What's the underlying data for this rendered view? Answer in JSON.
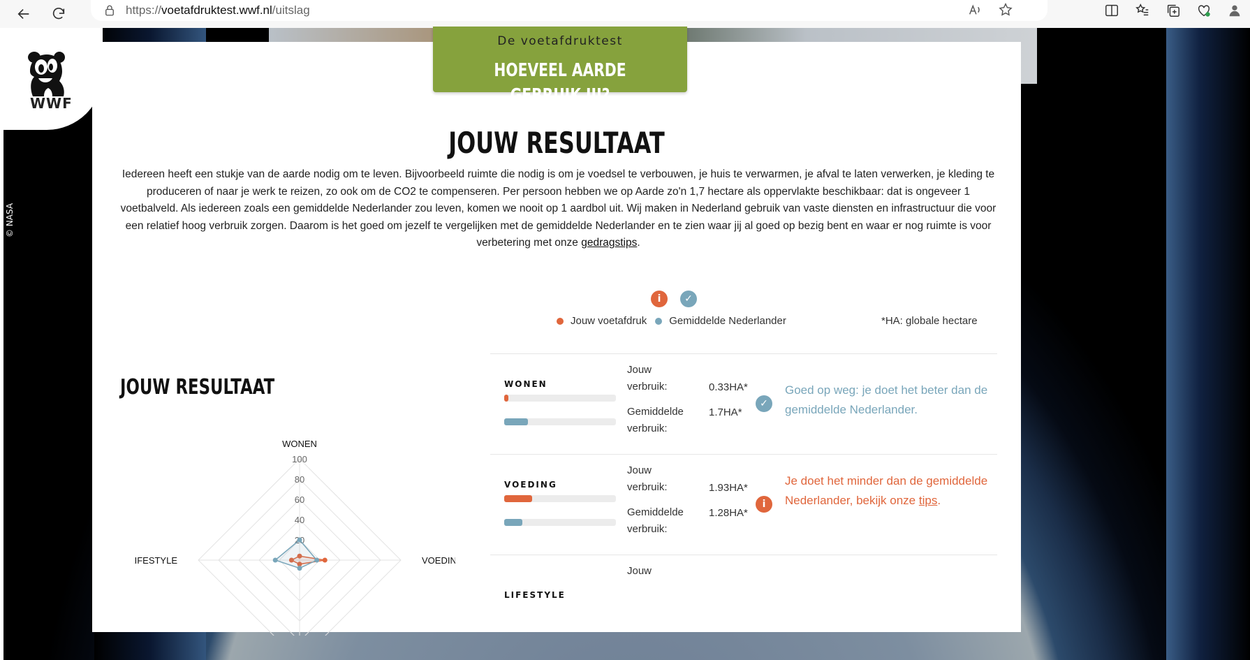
{
  "browser": {
    "url_prefix": "https://",
    "url_domain": "voetafdruktest.wwf.nl",
    "url_path": "/uitslag"
  },
  "brand": {
    "logo_text": "WWF",
    "image_credit": "© NASA"
  },
  "header": {
    "kicker": "De voetafdruktest",
    "headline": "HOEVEEL AARDE GEBRUIK JIJ?"
  },
  "result": {
    "title": "JOUW RESULTAAT",
    "intro": "Iedereen heeft een stukje van de aarde nodig om te leven. Bijvoorbeeld ruimte die nodig is om je voedsel te verbouwen, je huis te verwarmen, je afval te laten verwerken, je kleding te produceren of naar je werk te reizen, zo ook om de CO2 te compenseren. Per persoon hebben we op Aarde zo'n 1,7 hectare als oppervlakte beschikbaar: dat is ongeveer 1 voetbalveld. Als iedereen zoals een gemiddelde Nederlander zou leven, komen we nooit op 1 aardbol uit. Wij maken in Nederland gebruik van vaste diensten en infrastructuur die voor een relatief hoog verbruik zorgen. Daarom is het goed om jezelf te vergelijken met de gemiddelde Nederlander en te zien waar jij al goed op bezig bent en waar er nog ruimte is voor verbetering met onze",
    "intro_link": "gedragstips",
    "intro_end": "."
  },
  "legend": {
    "yours": "Jouw voetafdruk",
    "average": "Gemiddelde Nederlander",
    "ha_note": "*HA: globale hectare",
    "info_symbol": "i",
    "check_symbol": "✓"
  },
  "chart_section": {
    "title": "JOUW RESULTAAT"
  },
  "chart_data": {
    "type": "radar",
    "axes": [
      "WONEN",
      "VOEDING",
      "MOBILITEIT",
      "LIFESTYLE"
    ],
    "visible_axis_labels": [
      "WONEN",
      "VOEDING",
      "LIFESTYLE"
    ],
    "ticks": [
      "100",
      "80",
      "60",
      "40",
      "20"
    ],
    "range": [
      0,
      100
    ],
    "series": [
      {
        "name": "Jouw voetafdruk",
        "color": "#e0663c",
        "values": [
          4,
          25,
          4,
          8
        ]
      },
      {
        "name": "Gemiddelde Nederlander",
        "color": "#79a6ba",
        "values": [
          20,
          17,
          8,
          24
        ]
      }
    ]
  },
  "rows": [
    {
      "label": "WONEN",
      "yours_label": "Jouw verbruik:",
      "yours_value": "0.33HA*",
      "yours_fraction": 0.04,
      "avg_label": "Gemiddelde verbruik:",
      "avg_value": "1.7HA*",
      "avg_fraction": 0.21,
      "status": "good",
      "verdict": "Goed op weg: je doet het beter dan de gemiddelde Nederlander."
    },
    {
      "label": "VOEDING",
      "yours_label": "Jouw verbruik:",
      "yours_value": "1.93HA*",
      "yours_fraction": 0.25,
      "avg_label": "Gemiddelde verbruik:",
      "avg_value": "1.28HA*",
      "avg_fraction": 0.16,
      "status": "bad",
      "verdict": "Je doet het minder dan de gemiddelde Nederlander, bekijk onze",
      "verdict_link": "tips",
      "verdict_end": "."
    },
    {
      "label": "LIFESTYLE",
      "yours_label": "Jouw"
    }
  ],
  "colors": {
    "accent_green": "#86a23d",
    "yours": "#e0663c",
    "average": "#79a6ba"
  }
}
